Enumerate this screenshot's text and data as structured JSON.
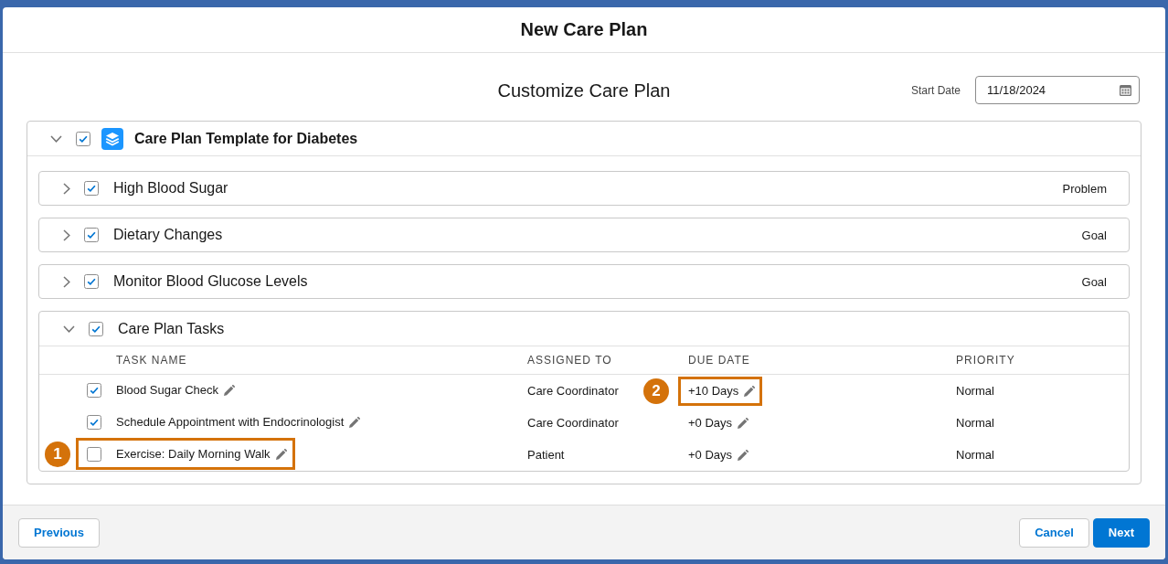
{
  "modal": {
    "title": "New Care Plan"
  },
  "page": {
    "heading": "Customize Care Plan",
    "start_date": {
      "label": "Start Date",
      "value": "11/18/2024"
    }
  },
  "template": {
    "title": "Care Plan Template for Diabetes",
    "checked": true,
    "expanded": true,
    "sections": [
      {
        "title": "High Blood Sugar",
        "category": "Problem",
        "checked": true,
        "expanded": false
      },
      {
        "title": "Dietary Changes",
        "category": "Goal",
        "checked": true,
        "expanded": false
      },
      {
        "title": "Monitor Blood Glucose Levels",
        "category": "Goal",
        "checked": true,
        "expanded": false
      }
    ],
    "tasks": {
      "title": "Care Plan Tasks",
      "checked": true,
      "expanded": true,
      "columns": [
        "TASK NAME",
        "ASSIGNED TO",
        "DUE DATE",
        "PRIORITY"
      ],
      "rows": [
        {
          "checked": true,
          "name": "Blood Sugar Check",
          "assigned_to": "Care Coordinator",
          "due_date": "+10 Days",
          "due_date_callout": "2",
          "priority": "Normal"
        },
        {
          "checked": true,
          "name": "Schedule Appointment with Endocrinologist",
          "assigned_to": "Care Coordinator",
          "due_date": "+0 Days",
          "priority": "Normal"
        },
        {
          "checked": false,
          "name": "Exercise: Daily Morning Walk",
          "name_callout": "1",
          "assigned_to": "Patient",
          "due_date": "+0 Days",
          "priority": "Normal"
        }
      ]
    }
  },
  "footer": {
    "left_buttons": [
      {
        "label": "Previous",
        "kind": "neutral"
      }
    ],
    "right_buttons": [
      {
        "label": "Cancel",
        "kind": "neutral"
      },
      {
        "label": "Next",
        "kind": "brand"
      }
    ]
  }
}
